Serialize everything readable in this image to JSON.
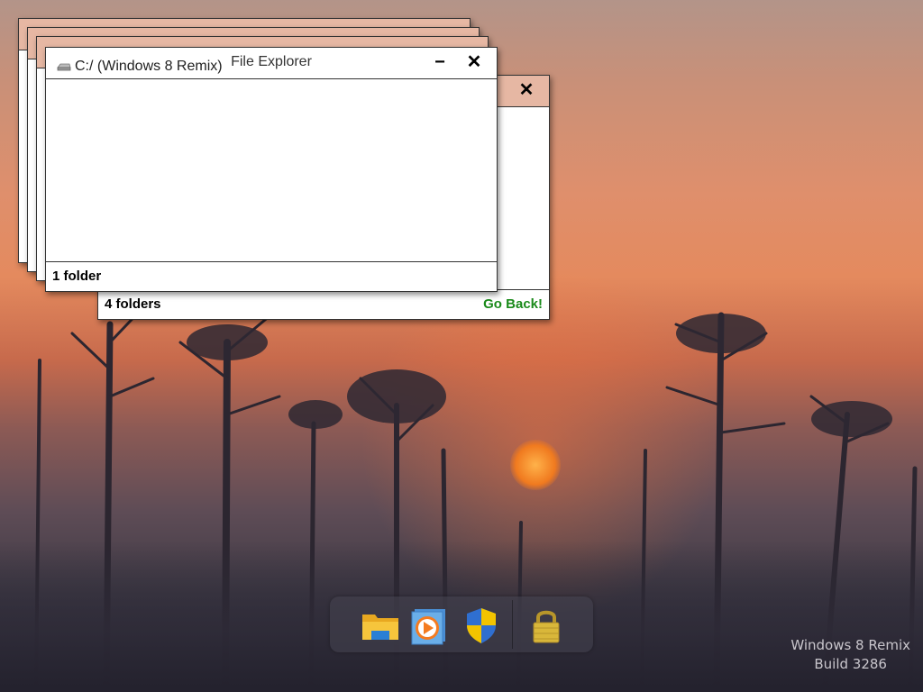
{
  "front_window": {
    "title": "File Explorer",
    "minimize_label": "−",
    "close_label": "✕",
    "drive": {
      "label": "C:/ (Windows 8 Remix)",
      "icon": "drive-icon"
    },
    "status": "1 folder"
  },
  "back_window": {
    "close_label": "✕",
    "status": "4 folders",
    "go_back_label": "Go Back!",
    "go_back_color": "#1a8a1a"
  },
  "taskbar": {
    "items": [
      {
        "name": "file-explorer",
        "icon": "folder-icon"
      },
      {
        "name": "media-player",
        "icon": "media-player-icon"
      },
      {
        "name": "security",
        "icon": "shield-icon"
      },
      {
        "name": "lock",
        "icon": "padlock-icon"
      }
    ]
  },
  "watermark": {
    "line1": "Windows 8 Remix",
    "line2": "Build 3286"
  },
  "colors": {
    "titlebar_tint": "#e6b7a3",
    "go_back": "#1a8a1a"
  }
}
